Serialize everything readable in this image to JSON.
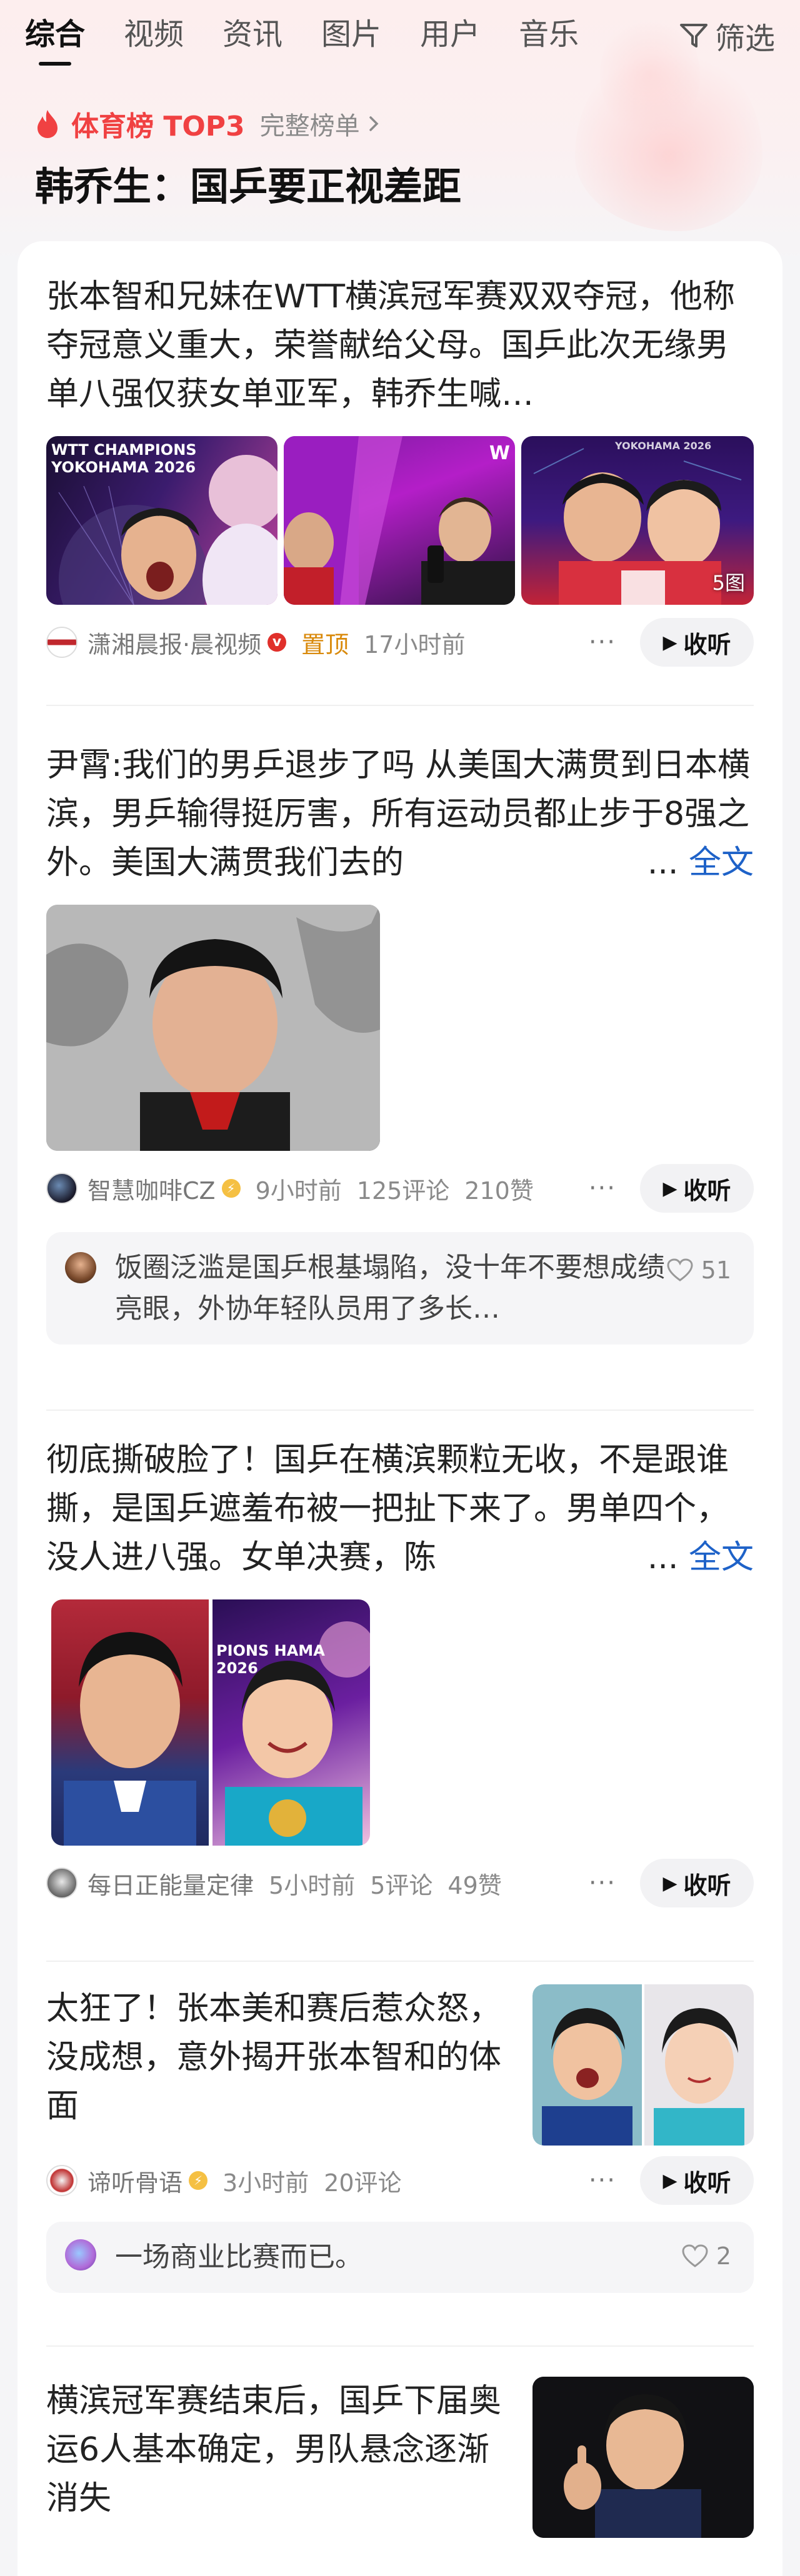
{
  "tabs": [
    {
      "label": "综合",
      "active": true
    },
    {
      "label": "视频"
    },
    {
      "label": "资讯"
    },
    {
      "label": "图片"
    },
    {
      "label": "用户"
    },
    {
      "label": "音乐"
    }
  ],
  "filter_label": "筛选",
  "hot": {
    "title": "体育榜 TOP3",
    "more": "完整榜单",
    "headline": "韩乔生：国乒要正视差距"
  },
  "colors": {
    "accent": "#f04142",
    "link": "#1e62c8",
    "pin": "#d98a0c"
  },
  "articles": [
    {
      "title": "张本智和兄妹在WTT横滨冠军赛双双夺冠，他称夺冠意义重大，荣誉献给父母。国乒此次无缘男单八强仅获女单亚军，韩乔生喊…",
      "images_count": "5图",
      "img1_text": "WTT CHAMPIONS YOKOHAMA 2026",
      "img2_text": "W",
      "img3_text": "YOKOHAMA 2026",
      "source": "潇湘晨报·晨视频",
      "pin": "置顶",
      "time": "17小时前",
      "listen": "收听"
    },
    {
      "title": "尹霄:我们的男乒退步了吗 从美国大满贯到日本横滨，男乒输得挺厉害，所有运动员都止步于8强之外。美国大满贯我们去的",
      "more_dots": "...",
      "more_link": "全文",
      "source": "智慧咖啡CZ",
      "time": "9小时前",
      "comments": "125评论",
      "likes": "210赞",
      "listen": "收听",
      "hot_comment": {
        "text": "饭圈泛滥是国乒根基塌陷，没十年不要想成绩亮眼，外协年轻队员用了多长…",
        "likes": "51"
      }
    },
    {
      "title": "彻底撕破脸了！国乒在横滨颗粒无收，不是跟谁撕，是国乒遮羞布被一把扯下来了。男单四个，没人进八强。女单决赛，陈",
      "more_dots": "...",
      "more_link": "全文",
      "img_text": "PIONS HAMA 2026",
      "source": "每日正能量定律",
      "time": "5小时前",
      "comments": "5评论",
      "likes": "49赞",
      "listen": "收听"
    },
    {
      "title": "太狂了！张本美和赛后惹众怒，没成想，意外揭开张本智和的体面",
      "source": "谛听骨语",
      "time": "3小时前",
      "comments": "20评论",
      "listen": "收听",
      "hot_comment": {
        "text": "一场商业比赛而已。",
        "likes": "2"
      }
    },
    {
      "title": "横滨冠军赛结束后，国乒下届奥运6人基本确定，男队悬念逐渐消失"
    }
  ]
}
